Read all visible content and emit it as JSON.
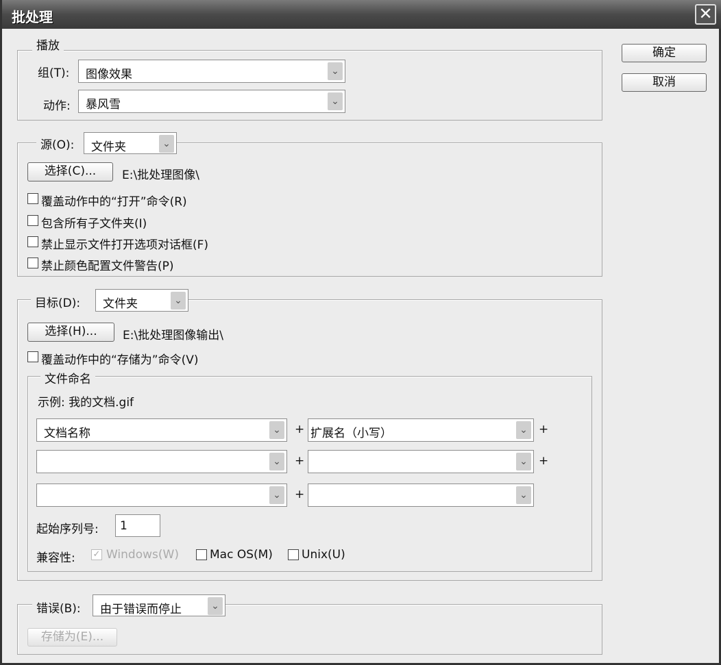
{
  "title": "批处理",
  "buttons": {
    "ok": "确定",
    "cancel": "取消"
  },
  "play": {
    "legend": "播放",
    "group_label": "组(T):",
    "group_value": "图像效果",
    "action_label": "动作:",
    "action_value": "暴风雪"
  },
  "source": {
    "label": "源(O):",
    "value": "文件夹",
    "choose": "选择(C)...",
    "path": "E:\\批处理图像\\",
    "checks": [
      "覆盖动作中的“打开”命令(R)",
      "包含所有子文件夹(I)",
      "禁止显示文件打开选项对话框(F)",
      "禁止颜色配置文件警告(P)"
    ]
  },
  "dest": {
    "label": "目标(D):",
    "value": "文件夹",
    "choose": "选择(H)...",
    "path": "E:\\批处理图像输出\\",
    "override": "覆盖动作中的“存储为”命令(V)",
    "naming": {
      "legend": "文件命名",
      "example": "示例: 我的文档.gif",
      "fields": [
        [
          "文档名称",
          "扩展名（小写）"
        ],
        [
          "",
          ""
        ],
        [
          "",
          ""
        ]
      ],
      "plus": "+",
      "serial_label": "起始序列号:",
      "serial_value": "1",
      "compat_label": "兼容性:",
      "compat": [
        {
          "label": "Windows(W)",
          "checked": true,
          "disabled": true
        },
        {
          "label": "Mac OS(M)",
          "checked": false
        },
        {
          "label": "Unix(U)",
          "checked": false
        }
      ]
    }
  },
  "errors": {
    "label": "错误(B):",
    "value": "由于错误而停止",
    "save_as": "存储为(E)..."
  }
}
